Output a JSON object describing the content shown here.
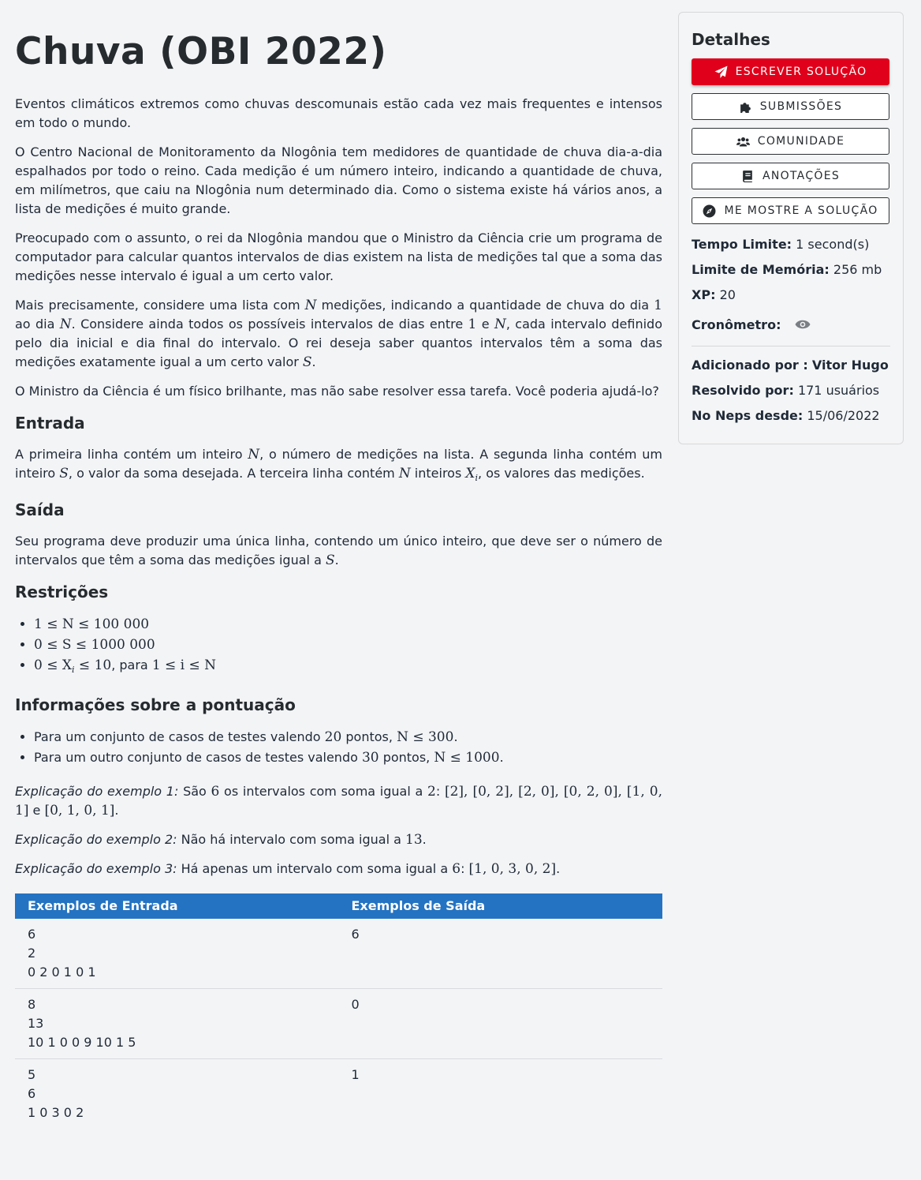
{
  "problem": {
    "title": "Chuva (OBI 2022)",
    "intro": [
      "Eventos climáticos extremos como chuvas descomunais estão cada vez mais frequentes e intensos em todo o mundo.",
      "O Centro Nacional de Monitoramento da Nlogônia tem medidores de quantidade de chuva dia-a-dia espalhados por todo o reino. Cada medição é um número inteiro, indicando a quantidade de chuva, em milímetros, que caiu na Nlogônia num determinado dia. Como o sistema existe há vários anos, a lista de medições é muito grande.",
      "Preocupado com o assunto, o rei da Nlogônia mandou que o Ministro da Ciência crie um programa de computador para calcular quantos intervalos de dias existem na lista de medições tal que a soma das medições nesse intervalo é igual a um certo valor."
    ],
    "p4": {
      "a": "Mais precisamente, considere uma lista com ",
      "b": " medições, indicando a quantidade de chuva do dia ",
      "c": " ao dia ",
      "d": ". Considere ainda todos os possíveis intervalos de dias entre ",
      "e": " e ",
      "f": ", cada intervalo definido pelo dia inicial e dia final do intervalo. O rei deseja saber quantos intervalos têm a soma das medições exatamente igual a um certo valor ",
      "g": "."
    },
    "p5": "O Ministro da Ciência é um físico brilhante, mas não sabe resolver essa tarefa. Você poderia ajudá-lo?",
    "entrada_title": "Entrada",
    "entrada": {
      "a": "A primeira linha contém um inteiro ",
      "b": ", o número de medições na lista. A segunda linha contém um inteiro ",
      "c": ", o valor da soma desejada. A terceira linha contém ",
      "d": " inteiros ",
      "e": ", os valores das medições."
    },
    "saida_title": "Saída",
    "saida": {
      "a": "Seu programa deve produzir uma única linha, contendo um único inteiro, que deve ser o número de intervalos que têm a soma das medições igual a ",
      "b": "."
    },
    "restricoes_title": "Restrições",
    "restricoes": {
      "r1": "1 ≤ N ≤ 100 000",
      "r2": "0 ≤ S ≤ 1000 000",
      "r3a": "0 ≤ X",
      "r3b": " ≤ 10",
      "r3c": ", para ",
      "r3d": "1 ≤ i ≤ N"
    },
    "pontuacao_title": "Informações sobre a pontuação",
    "pontuacao": {
      "a1": "Para um conjunto de casos de testes valendo ",
      "a2": "20",
      "a3": " pontos, ",
      "a4": "N ≤ 300",
      "a5": ".",
      "b1": "Para um outro conjunto de casos de testes valendo ",
      "b2": "30",
      "b3": " pontos, ",
      "b4": "N ≤ 1000",
      "b5": "."
    },
    "expl1": {
      "label": "Explicação do exemplo 1:",
      "a": " São ",
      "b": "6",
      "c": " os intervalos com soma igual a ",
      "d": "2",
      "e": ": ",
      "f": "[2], [0, 2], [2, 0], [0, 2, 0], [1, 0, 1]",
      "g": " e ",
      "h": "[0, 1, 0, 1]",
      "i": "."
    },
    "expl2": {
      "label": "Explicação do exemplo 2:",
      "a": " Não há intervalo com soma igual a ",
      "b": "13",
      "c": "."
    },
    "expl3": {
      "label": "Explicação do exemplo 3:",
      "a": " Há apenas um intervalo com soma igual a ",
      "b": "6",
      "c": ": ",
      "d": "[1, 0, 3, 0, 2]",
      "e": "."
    },
    "vars": {
      "N": "N",
      "S": "S",
      "X": "X",
      "i": "i",
      "one": "1"
    },
    "examples": {
      "head_in": "Exemplos de Entrada",
      "head_out": "Exemplos de Saída",
      "rows": [
        {
          "in": [
            "6",
            "2",
            "0 2 0 1 0 1"
          ],
          "out": "6"
        },
        {
          "in": [
            "8",
            "13",
            "10 1 0 0 9 10 1 5"
          ],
          "out": "0"
        },
        {
          "in": [
            "5",
            "6",
            "1 0 3 0 2"
          ],
          "out": "1"
        }
      ]
    }
  },
  "details": {
    "title": "Detalhes",
    "buttons": {
      "write": "ESCREVER SOLUÇÃO",
      "submissions": "SUBMISSÕES",
      "community": "COMUNIDADE",
      "notes": "ANOTAÇÕES",
      "show": "ME MOSTRE A SOLUÇÃO"
    },
    "time_label": "Tempo Limite:",
    "time_value": "1 second(s)",
    "mem_label": "Limite de Memória:",
    "mem_value": "256 mb",
    "xp_label": "XP:",
    "xp_value": "20",
    "timer_label": "Cronômetro:",
    "added_label": "Adicionado por :",
    "added_value": "Vitor Hugo",
    "solved_label": "Resolvido por:",
    "solved_value": "171 usuários",
    "since_label": "No Neps desde:",
    "since_value": "15/06/2022"
  },
  "colors": {
    "primary": "#e0001b",
    "table_header": "#2473c2"
  },
  "icons": [
    "paper-plane-icon",
    "puzzle-icon",
    "users-icon",
    "book-icon",
    "compass-icon",
    "eye-icon"
  ]
}
